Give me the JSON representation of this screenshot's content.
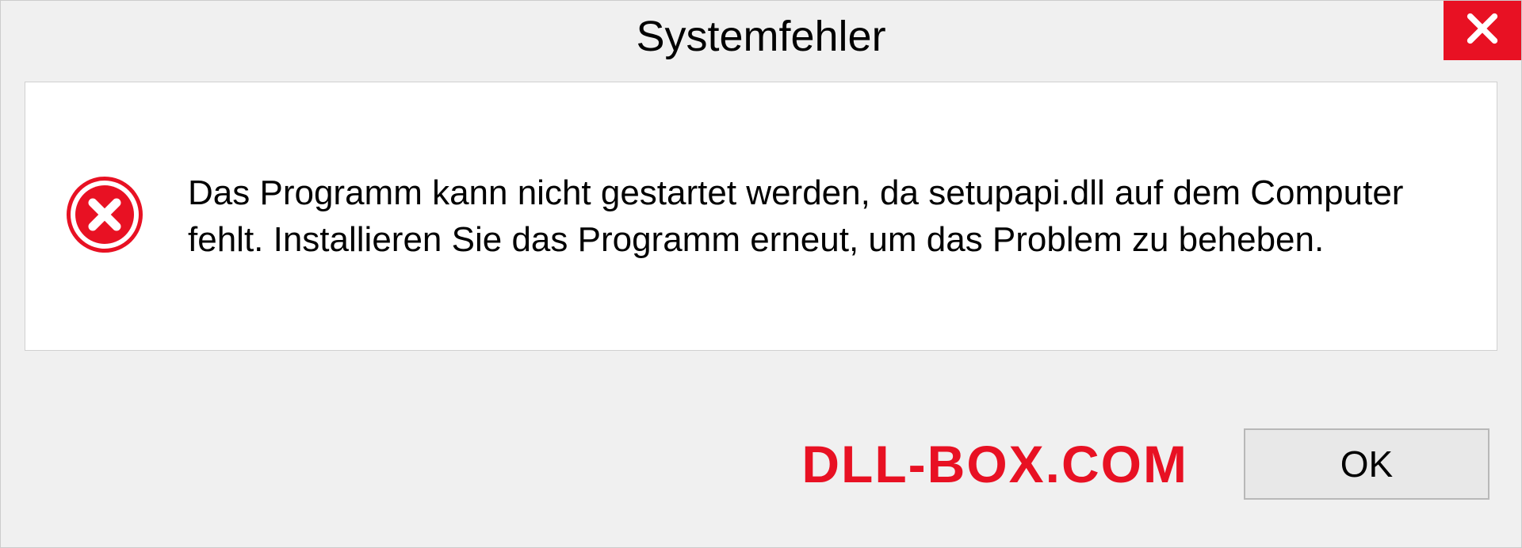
{
  "dialog": {
    "title": "Systemfehler",
    "message": "Das Programm kann nicht gestartet werden, da setupapi.dll auf dem Computer fehlt. Installieren Sie das Programm erneut, um das Problem zu beheben.",
    "ok_label": "OK"
  },
  "watermark": "DLL-BOX.COM"
}
